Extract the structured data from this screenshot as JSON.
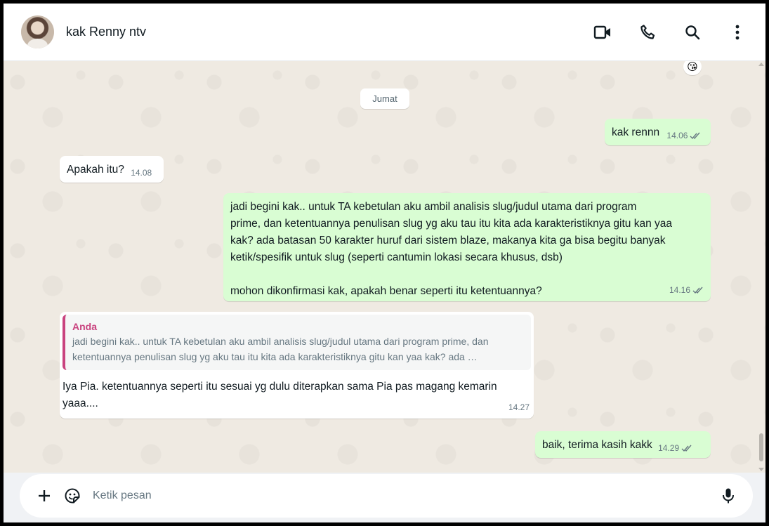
{
  "header": {
    "contact_name": "kak Renny ntv",
    "icons": [
      "video-call-icon",
      "voice-call-icon",
      "search-icon",
      "menu-icon"
    ]
  },
  "chat": {
    "top_reaction_emoji": "😘",
    "date_separator": "Jumat",
    "messages": [
      {
        "direction": "out",
        "text": "kak rennn",
        "time": "14.06",
        "status": "read"
      },
      {
        "direction": "in",
        "text": "Apakah itu?",
        "time": "14.08"
      },
      {
        "direction": "out",
        "text": "jadi begini kak.. untuk TA kebetulan aku ambil analisis slug/judul utama dari program\nprime, dan ketentuannya penulisan slug yg aku tau itu kita ada karakteristiknya gitu kan yaa\nkak? ada batasan 50 karakter huruf dari sistem blaze, makanya kita ga bisa begitu banyak\nketik/spesifik untuk slug (seperti cantumin lokasi secara khusus, dsb)\n\nmohon dikonfirmasi kak, apakah benar seperti itu ketentuannya?",
        "time": "14.16",
        "status": "read"
      },
      {
        "direction": "in",
        "quote_author": "Anda",
        "quote_text": "jadi begini kak.. untuk TA kebetulan aku ambil analisis slug/judul utama dari program prime, dan\nketentuannya penulisan slug yg aku tau itu kita ada karakteristiknya gitu kan yaa kak? ada …",
        "text": "Iya Pia. ketentuannya seperti itu sesuai yg dulu diterapkan sama Pia pas magang kemarin\nyaaa....",
        "time": "14.27"
      },
      {
        "direction": "out",
        "text": "baik, terima kasih kakk",
        "time": "14.29",
        "status": "read"
      }
    ]
  },
  "composer": {
    "placeholder": "Ketik pesan",
    "icons": [
      "attach-plus-icon",
      "sticker-icon",
      "microphone-icon"
    ]
  },
  "colors": {
    "outgoing_bubble": "#d9fdd3",
    "incoming_bubble": "#ffffff",
    "chat_background": "#efeae2",
    "quote_accent": "#c9437f",
    "read_ticks": "#667781"
  }
}
